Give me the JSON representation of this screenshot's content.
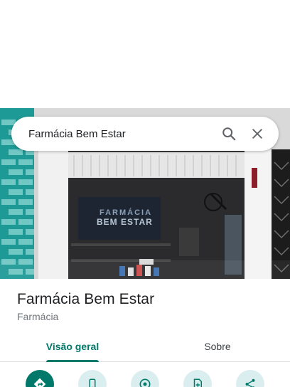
{
  "search": {
    "query": "Farmácia Bem Estar",
    "search_icon": "search-icon",
    "close_icon": "close-icon"
  },
  "photo": {
    "sign_line1": "FARMÁCIA",
    "sign_line2": "BEM ESTAR"
  },
  "place": {
    "name": "Farmácia Bem Estar",
    "category": "Farmácia"
  },
  "tabs": [
    {
      "label": "Visão geral",
      "active": true
    },
    {
      "label": "Sobre",
      "active": false
    }
  ],
  "actions": [
    {
      "icon": "directions-icon"
    },
    {
      "icon": "phone-icon"
    },
    {
      "icon": "nearby-icon"
    },
    {
      "icon": "save-icon"
    },
    {
      "icon": "share-icon"
    }
  ],
  "colors": {
    "accent": "#00796b",
    "action_bg": "#dbeeef",
    "text_primary": "#202124",
    "text_secondary": "#70757a",
    "tile_teal": "#1e9a96"
  }
}
